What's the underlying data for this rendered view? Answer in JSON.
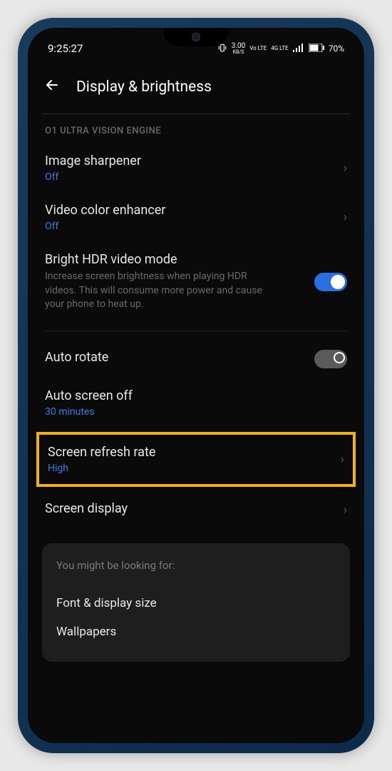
{
  "status": {
    "time": "9:25:27",
    "net_speed": "3.00",
    "net_unit": "KB/S",
    "lte1": "Vo LTE",
    "lte2": "4G LTE",
    "battery": "70%"
  },
  "header": {
    "title": "Display & brightness"
  },
  "section": {
    "vision_engine": "O1 ULTRA VISION ENGINE"
  },
  "settings": {
    "image_sharpener": {
      "title": "Image sharpener",
      "value": "Off"
    },
    "video_color": {
      "title": "Video color enhancer",
      "value": "Off"
    },
    "hdr": {
      "title": "Bright HDR video mode",
      "desc": "Increase screen brightness when playing HDR videos. This will consume more power and cause your phone to heat up."
    },
    "auto_rotate": {
      "title": "Auto rotate"
    },
    "auto_off": {
      "title": "Auto screen off",
      "value": "30 minutes"
    },
    "refresh": {
      "title": "Screen refresh rate",
      "value": "High"
    },
    "display": {
      "title": "Screen display"
    }
  },
  "suggestions": {
    "header": "You might be looking for:",
    "items": [
      "Font & display size",
      "Wallpapers"
    ]
  }
}
